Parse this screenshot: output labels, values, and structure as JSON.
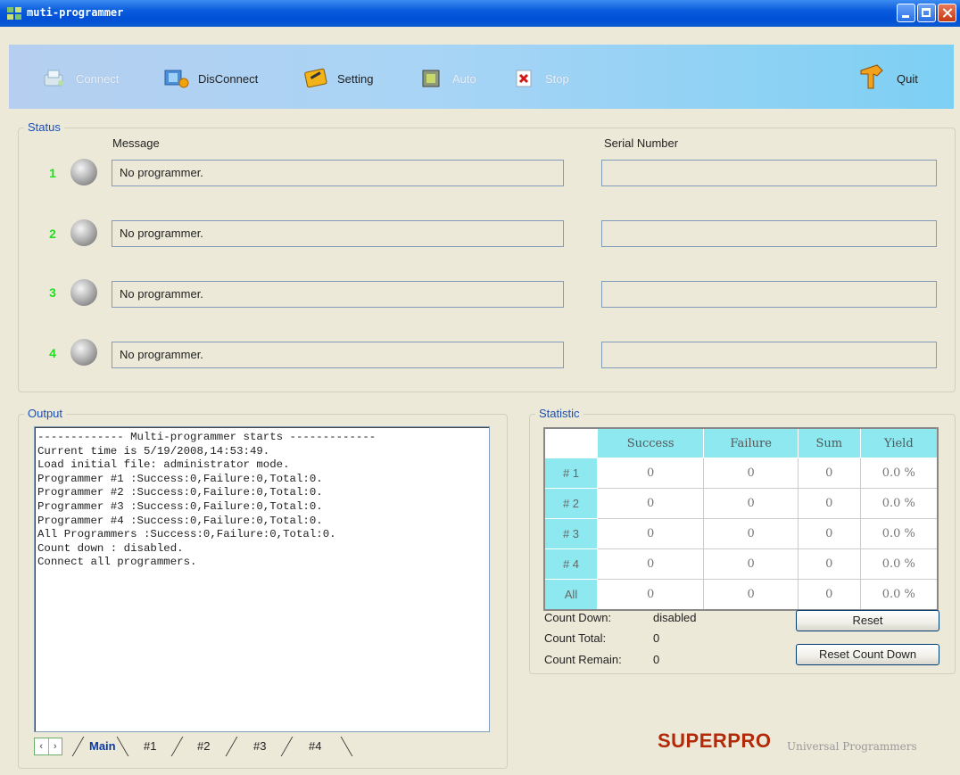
{
  "window": {
    "title": "muti-programmer"
  },
  "toolbar": {
    "connect": "Connect",
    "disconnect": "DisConnect",
    "setting": "Setting",
    "auto": "Auto",
    "stop": "Stop",
    "quit": "Quit"
  },
  "status": {
    "legend": "Status",
    "message_header": "Message",
    "serial_header": "Serial Number",
    "rows": [
      {
        "num": "1",
        "message": "No programmer.",
        "serial": ""
      },
      {
        "num": "2",
        "message": "No programmer.",
        "serial": ""
      },
      {
        "num": "3",
        "message": "No programmer.",
        "serial": ""
      },
      {
        "num": "4",
        "message": "No programmer.",
        "serial": ""
      }
    ]
  },
  "output": {
    "legend": "Output",
    "lines": [
      "------------- Multi-programmer starts -------------",
      "Current time is 5/19/2008,14:53:49.",
      "Load initial file: administrator mode.",
      "Programmer #1 :Success:0,Failure:0,Total:0.",
      "Programmer #2 :Success:0,Failure:0,Total:0.",
      "Programmer #3 :Success:0,Failure:0,Total:0.",
      "Programmer #4 :Success:0,Failure:0,Total:0.",
      "All Programmers :Success:0,Failure:0,Total:0.",
      "Count down : disabled.",
      "Connect all programmers."
    ],
    "tabs": [
      "Main",
      "#1",
      "#2",
      "#3",
      "#4"
    ],
    "active_tab": "Main"
  },
  "statistic": {
    "legend": "Statistic",
    "columns": [
      "Success",
      "Failure",
      "Sum",
      "Yield"
    ],
    "rows": [
      {
        "label": "# 1",
        "success": "0",
        "failure": "0",
        "sum": "0",
        "yield": "0.0 %"
      },
      {
        "label": "# 2",
        "success": "0",
        "failure": "0",
        "sum": "0",
        "yield": "0.0 %"
      },
      {
        "label": "# 3",
        "success": "0",
        "failure": "0",
        "sum": "0",
        "yield": "0.0 %"
      },
      {
        "label": "# 4",
        "success": "0",
        "failure": "0",
        "sum": "0",
        "yield": "0.0 %"
      },
      {
        "label": "All",
        "success": "0",
        "failure": "0",
        "sum": "0",
        "yield": "0.0 %"
      }
    ],
    "count_down_label": "Count Down:",
    "count_down_value": "disabled",
    "count_total_label": "Count Total:",
    "count_total_value": "0",
    "count_remain_label": "Count Remain:",
    "count_remain_value": "0",
    "reset_button": "Reset",
    "reset_count_down_button": "Reset Count Down"
  },
  "brand": {
    "name": "SUPERPRO",
    "tagline": "Universal Programmers"
  },
  "colors": {
    "led_indicator": "#22dd22",
    "table_header": "#8ee8f0",
    "brand": "#b22a0a",
    "legend": "#1c4fb3"
  }
}
